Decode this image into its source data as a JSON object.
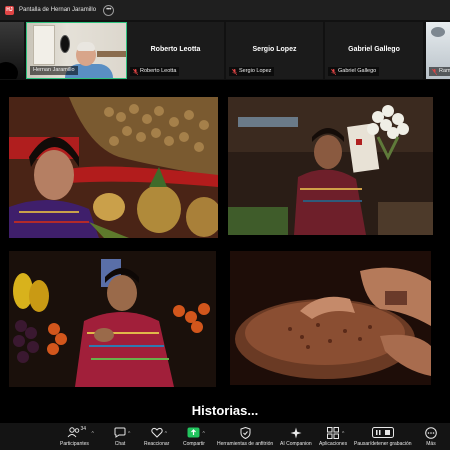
{
  "window": {
    "badge": "HJ",
    "title": "Pantalla de Hernan Jaramillo",
    "more_glyph": "•••"
  },
  "participants": [
    {
      "name": "Hernan Jaramillo",
      "video": true,
      "active_speaker": true
    },
    {
      "name": "Roberto Leotta",
      "video": false,
      "muted": true
    },
    {
      "name": "Sergio Lopez",
      "video": false,
      "muted": true
    },
    {
      "name": "Gabriel Gallego",
      "video": false,
      "muted": true
    },
    {
      "name": "Ramo",
      "video": true,
      "muted": true
    }
  ],
  "shared_content": {
    "caption": "Historias...",
    "photos": [
      {
        "subject": "woman with fruit and peanuts market"
      },
      {
        "subject": "woman holding flower bouquet"
      },
      {
        "subject": "woman in colorful huipil at market"
      },
      {
        "subject": "hands grinding cacao on stone"
      }
    ]
  },
  "toolbar": {
    "participants_label": "Participantes",
    "participants_count": "34",
    "chat_label": "Chat",
    "reactions_label": "Reaccionar",
    "share_label": "Compartir",
    "host_tools_label": "Herramientas de anfitrión",
    "companion_label": "AI Companion",
    "apps_label": "Aplicaciones",
    "record_label": "Pausar/detener grabación",
    "more_label": "Más"
  },
  "colors": {
    "active_speaker_border": "#2ec27e",
    "muted_icon": "#e04545",
    "share_icon": "#22c55e",
    "toolbar_bg": "#141414"
  }
}
